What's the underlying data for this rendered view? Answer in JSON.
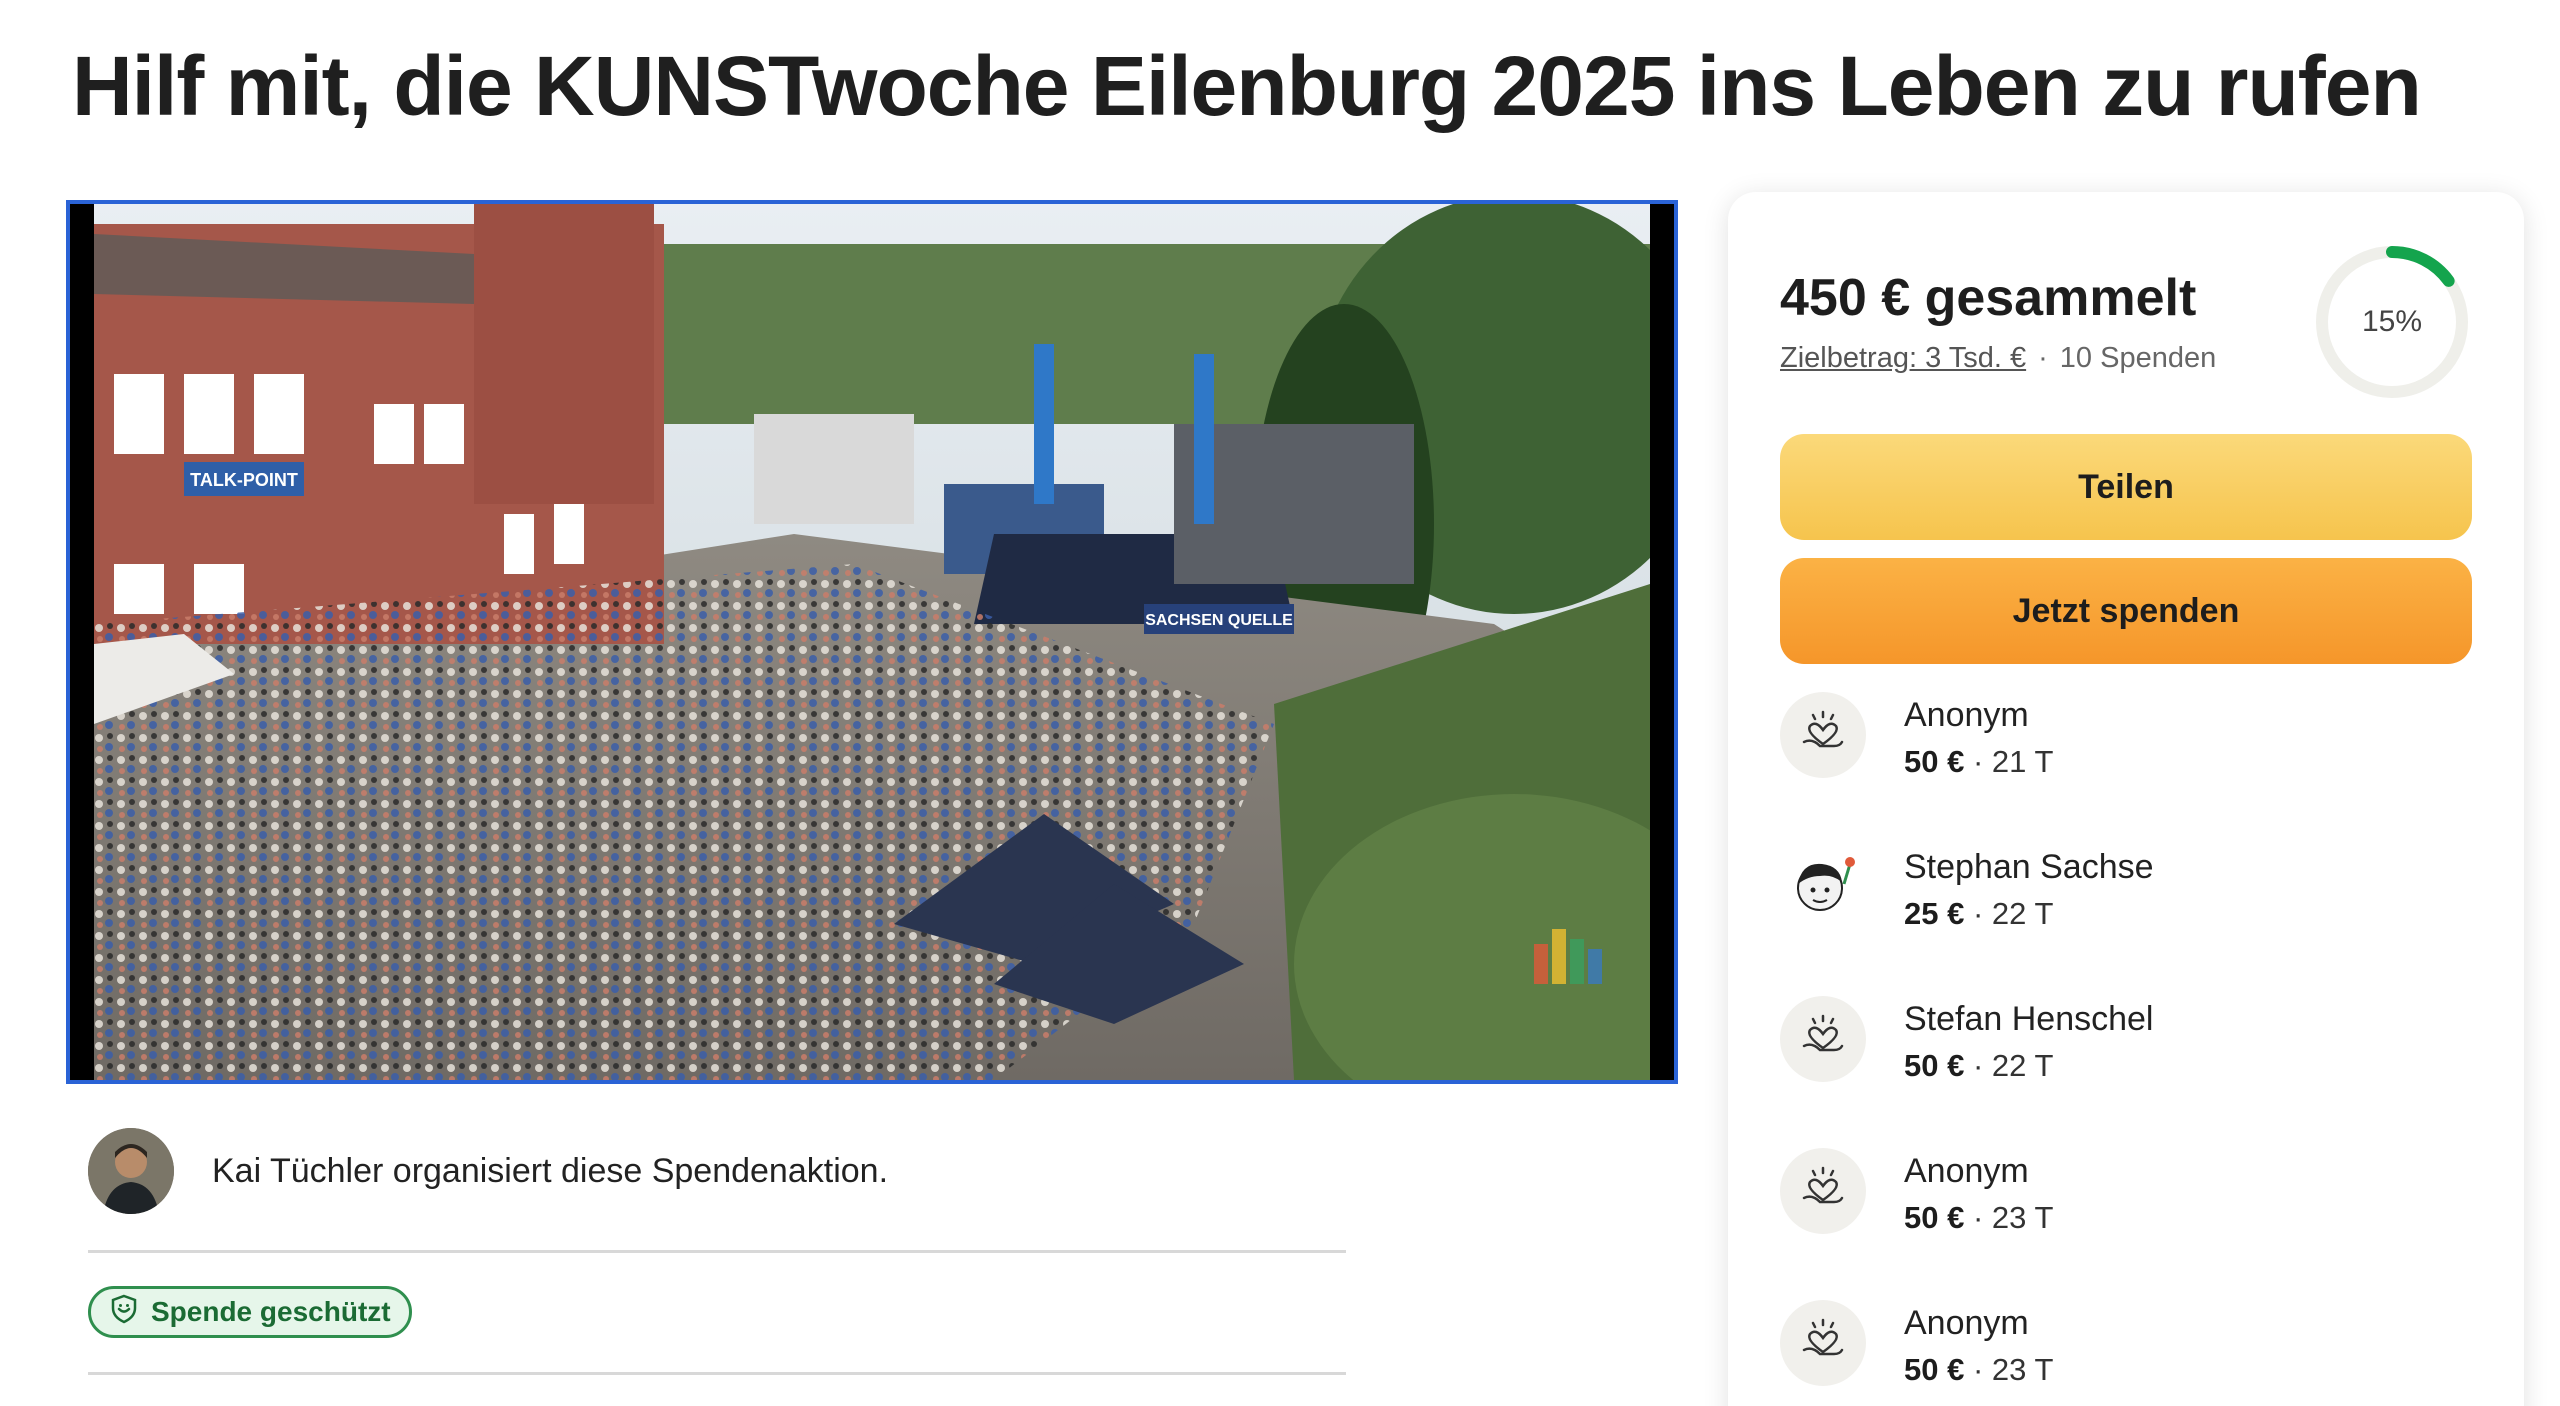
{
  "page": {
    "title": "Hilf mit, die KUNSTwoche Eilenburg 2025 ins Leben zu rufen"
  },
  "organizer": {
    "text": "Kai Tüchler organisiert diese Spendenaktion."
  },
  "badge": {
    "label": "Spende geschützt",
    "icon": "shield-icon"
  },
  "summary": {
    "raised": "450 € gesammelt",
    "goal": "Zielbetrag: 3 Tsd. €",
    "separator": "·",
    "donation_count": "10 Spenden",
    "progress_label": "15%",
    "progress_fraction": 0.15
  },
  "buttons": {
    "share": "Teilen",
    "donate": "Jetzt spenden"
  },
  "donations": [
    {
      "name": "Anonym",
      "amount": "50 €",
      "age": "· 21 T",
      "icon": "heart-hand-icon"
    },
    {
      "name": "Stephan Sachse",
      "amount": "25 €",
      "age": "· 22 T",
      "icon": "avatar"
    },
    {
      "name": "Stefan Henschel",
      "amount": "50 €",
      "age": "· 22 T",
      "icon": "heart-hand-icon"
    },
    {
      "name": "Anonym",
      "amount": "50 €",
      "age": "· 23 T",
      "icon": "heart-hand-icon"
    },
    {
      "name": "Anonym",
      "amount": "50 €",
      "age": "· 23 T",
      "icon": "heart-hand-icon"
    }
  ],
  "image_texts": {
    "sign1": "TALK-POINT",
    "sign2": "SACHSEN QUELLE"
  },
  "colors": {
    "share_button": "#f6c44d",
    "donate_button": "#f5962a",
    "progress": "#14a44d",
    "badge_border": "#2f8f4e",
    "media_border": "#2a63d6"
  }
}
